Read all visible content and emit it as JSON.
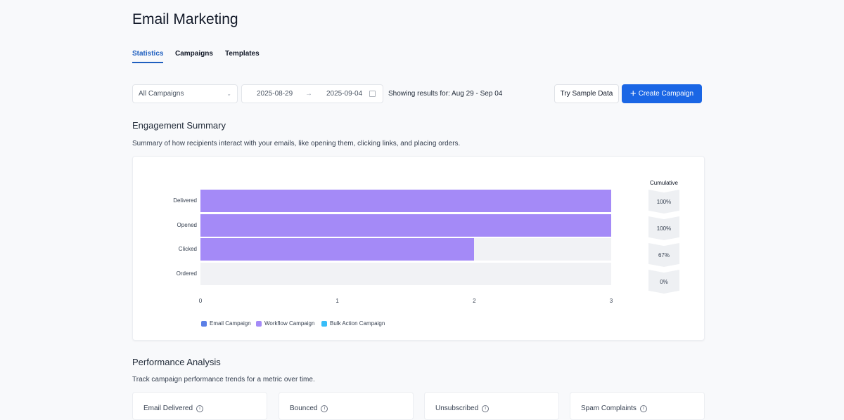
{
  "header": {
    "title": "Email Marketing"
  },
  "tabs": [
    {
      "label": "Statistics",
      "active": true
    },
    {
      "label": "Campaigns"
    },
    {
      "label": "Templates"
    }
  ],
  "filters": {
    "campaign_select": "All Campaigns",
    "date_from": "2025-08-29",
    "date_to": "2025-09-04",
    "results_text": "Showing results for: Aug 29 - Sep 04",
    "sample_button": "Try Sample Data",
    "create_button": "Create Campaign"
  },
  "engagement": {
    "title": "Engagement Summary",
    "description": "Summary of how recipients interact with your emails, like opening them, clicking links, and placing orders.",
    "cumulative_label": "Cumulative"
  },
  "chart_data": {
    "type": "bar",
    "orientation": "horizontal",
    "categories": [
      "Delivered",
      "Opened",
      "Clicked",
      "Ordered"
    ],
    "series": [
      {
        "name": "Email Campaign",
        "color": "#5b7fe6",
        "values": [
          0,
          0,
          0,
          0
        ]
      },
      {
        "name": "Workflow Campaign",
        "color": "#a48af7",
        "values": [
          3,
          3,
          2,
          0
        ]
      },
      {
        "name": "Bulk Action Campaign",
        "color": "#38bdf8",
        "values": [
          0,
          0,
          0,
          0
        ]
      }
    ],
    "xlim": [
      0,
      3
    ],
    "xticks": [
      "0",
      "1",
      "2",
      "3"
    ],
    "cumulative": [
      "100%",
      "100%",
      "67%",
      "0%"
    ],
    "legend": "bottom-left"
  },
  "performance": {
    "title": "Performance Analysis",
    "description": "Track campaign performance trends for a metric over time.",
    "metrics": [
      "Email Delivered",
      "Bounced",
      "Unsubscribed",
      "Spam Complaints"
    ]
  }
}
